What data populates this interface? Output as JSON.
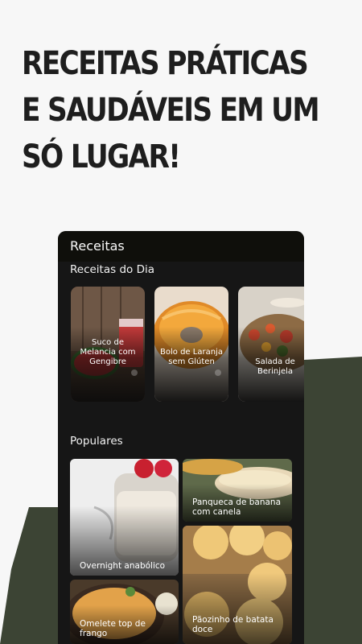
{
  "headline": {
    "line1": "RECEITAS PRÁTICAS",
    "line2": "E SAUDÁVEIS EM UM",
    "line3": "SÓ LUGAR!"
  },
  "app": {
    "title": "Receitas",
    "daily_section": "Receitas do Dia",
    "popular_section": "Populares"
  },
  "daily_recipes": [
    {
      "name": "Suco de Melancia com Gengibre"
    },
    {
      "name": "Bolo de Laranja sem Glúten"
    },
    {
      "name": "Salada de Berinjela"
    }
  ],
  "popular_recipes": [
    {
      "name": "Overnight anabólico"
    },
    {
      "name": "Panqueca de banana com canela"
    },
    {
      "name": "Omelete top de frango"
    },
    {
      "name": "Pãozinho de batata doce"
    }
  ],
  "colors": {
    "page_background": "#f7f7f7",
    "olive_shape": "#3c4434",
    "headline": "#1e1e1e",
    "phone_surface": "#161616",
    "app_bar": "#0f0f0b"
  }
}
